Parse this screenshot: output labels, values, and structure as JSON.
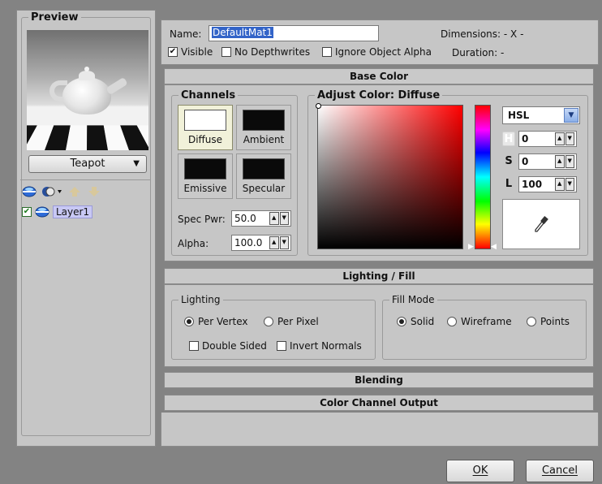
{
  "preview": {
    "title": "Preview",
    "model_dropdown": "Teapot",
    "layer_label": "Layer1",
    "layer_checked": true
  },
  "header": {
    "name_label": "Name:",
    "name_value": "DefaultMat1",
    "dimensions": "Dimensions: - X -",
    "visible_label": "Visible",
    "visible_checked": true,
    "no_depthwrites_label": "No Depthwrites",
    "ignore_alpha_label": "Ignore Object Alpha",
    "duration": "Duration: -"
  },
  "base_color": {
    "section_title": "Base Color",
    "channels_title": "Channels",
    "channels": [
      {
        "label": "Diffuse",
        "color": "#ffffff",
        "selected": true
      },
      {
        "label": "Ambient",
        "color": "#0a0a0a",
        "selected": false
      },
      {
        "label": "Emissive",
        "color": "#0a0a0a",
        "selected": false
      },
      {
        "label": "Specular",
        "color": "#0a0a0a",
        "selected": false
      }
    ],
    "spec_pwr_label": "Spec Pwr:",
    "spec_pwr_value": "50.0",
    "alpha_label": "Alpha:",
    "alpha_value": "100.0",
    "adjust_title": "Adjust Color: Diffuse",
    "color_model": "HSL",
    "h_label": "H",
    "h_value": "0",
    "s_label": "S",
    "s_value": "0",
    "l_label": "L",
    "l_value": "100"
  },
  "lighting": {
    "section_title": "Lighting / Fill",
    "lighting_group": "Lighting",
    "per_vertex": "Per Vertex",
    "per_pixel": "Per Pixel",
    "lighting_selected": "Per Vertex",
    "double_sided": "Double Sided",
    "invert_normals": "Invert Normals",
    "fill_group": "Fill Mode",
    "solid": "Solid",
    "wireframe": "Wireframe",
    "points": "Points",
    "fill_selected": "Solid"
  },
  "blending": {
    "section_title": "Blending"
  },
  "color_output": {
    "section_title": "Color Channel Output"
  },
  "footer": {
    "ok": "OK",
    "cancel": "Cancel"
  },
  "colors": {
    "accent": "#3364c8",
    "panel": "#c6c6c6",
    "backdrop": "#838383",
    "layer_highlight": "#c8c8f4"
  }
}
